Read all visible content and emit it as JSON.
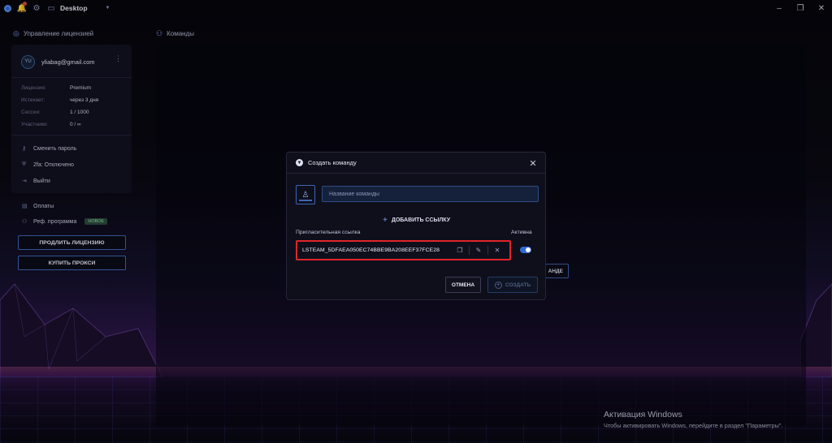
{
  "topbar": {
    "workspace": "Desktop",
    "icons": [
      "app-logo-icon",
      "bell-icon",
      "gear-icon",
      "desktop-icon",
      "chevron-down-icon"
    ],
    "window_controls": [
      "minimize-icon",
      "restore-icon",
      "close-icon"
    ]
  },
  "sidebar": {
    "section_title": "Управление лицензией",
    "account": {
      "avatar_initials": "YU",
      "email": "yliabag@gmail.com"
    },
    "info": [
      {
        "key": "Лицензия:",
        "value": "Premium"
      },
      {
        "key": "Истекает:",
        "value": "через 3 дня"
      },
      {
        "key": "Сессии:",
        "value": "1 / 1000"
      },
      {
        "key": "Участники:",
        "value": "0 / ∞"
      }
    ],
    "menu": [
      {
        "label": "Сменить пароль",
        "icon": "key-icon"
      },
      {
        "label": "2fa: Отключено",
        "icon": "shield-icon"
      },
      {
        "label": "Выйти",
        "icon": "logout-icon"
      }
    ],
    "menu2": [
      {
        "label": "Оплаты",
        "icon": "payment-icon"
      },
      {
        "label": "Реф. программа",
        "icon": "referral-icon",
        "badge": "НОВОЕ"
      }
    ],
    "buttons": {
      "extend": "ПРОДЛИТЬ ЛИЦЕНЗИЮ",
      "buy_proxy": "КУПИТЬ ПРОКСИ"
    }
  },
  "main": {
    "section_title": "Команды",
    "background_button": "АНДЕ"
  },
  "modal": {
    "title": "Создать команду",
    "team_name_placeholder": "Название команды",
    "add_link": "ДОБАВИТЬ ССЫЛКУ",
    "col_invite": "Пригласительная ссылка",
    "col_active": "Активна",
    "invite_link": "LSTEAM_5DFAEA050EC74BBE9BA208EEF37FCE28",
    "active": true,
    "cancel": "ОТМЕНА",
    "create": "СОЗДАТЬ"
  },
  "os_watermark": {
    "title": "Активация Windows",
    "subtitle": "Чтобы активировать Windows, перейдите в раздел \"Параметры\"."
  },
  "colors": {
    "accent": "#2f6bd8",
    "highlight": "#e0252a",
    "badge_bg": "#2c4a3c"
  }
}
